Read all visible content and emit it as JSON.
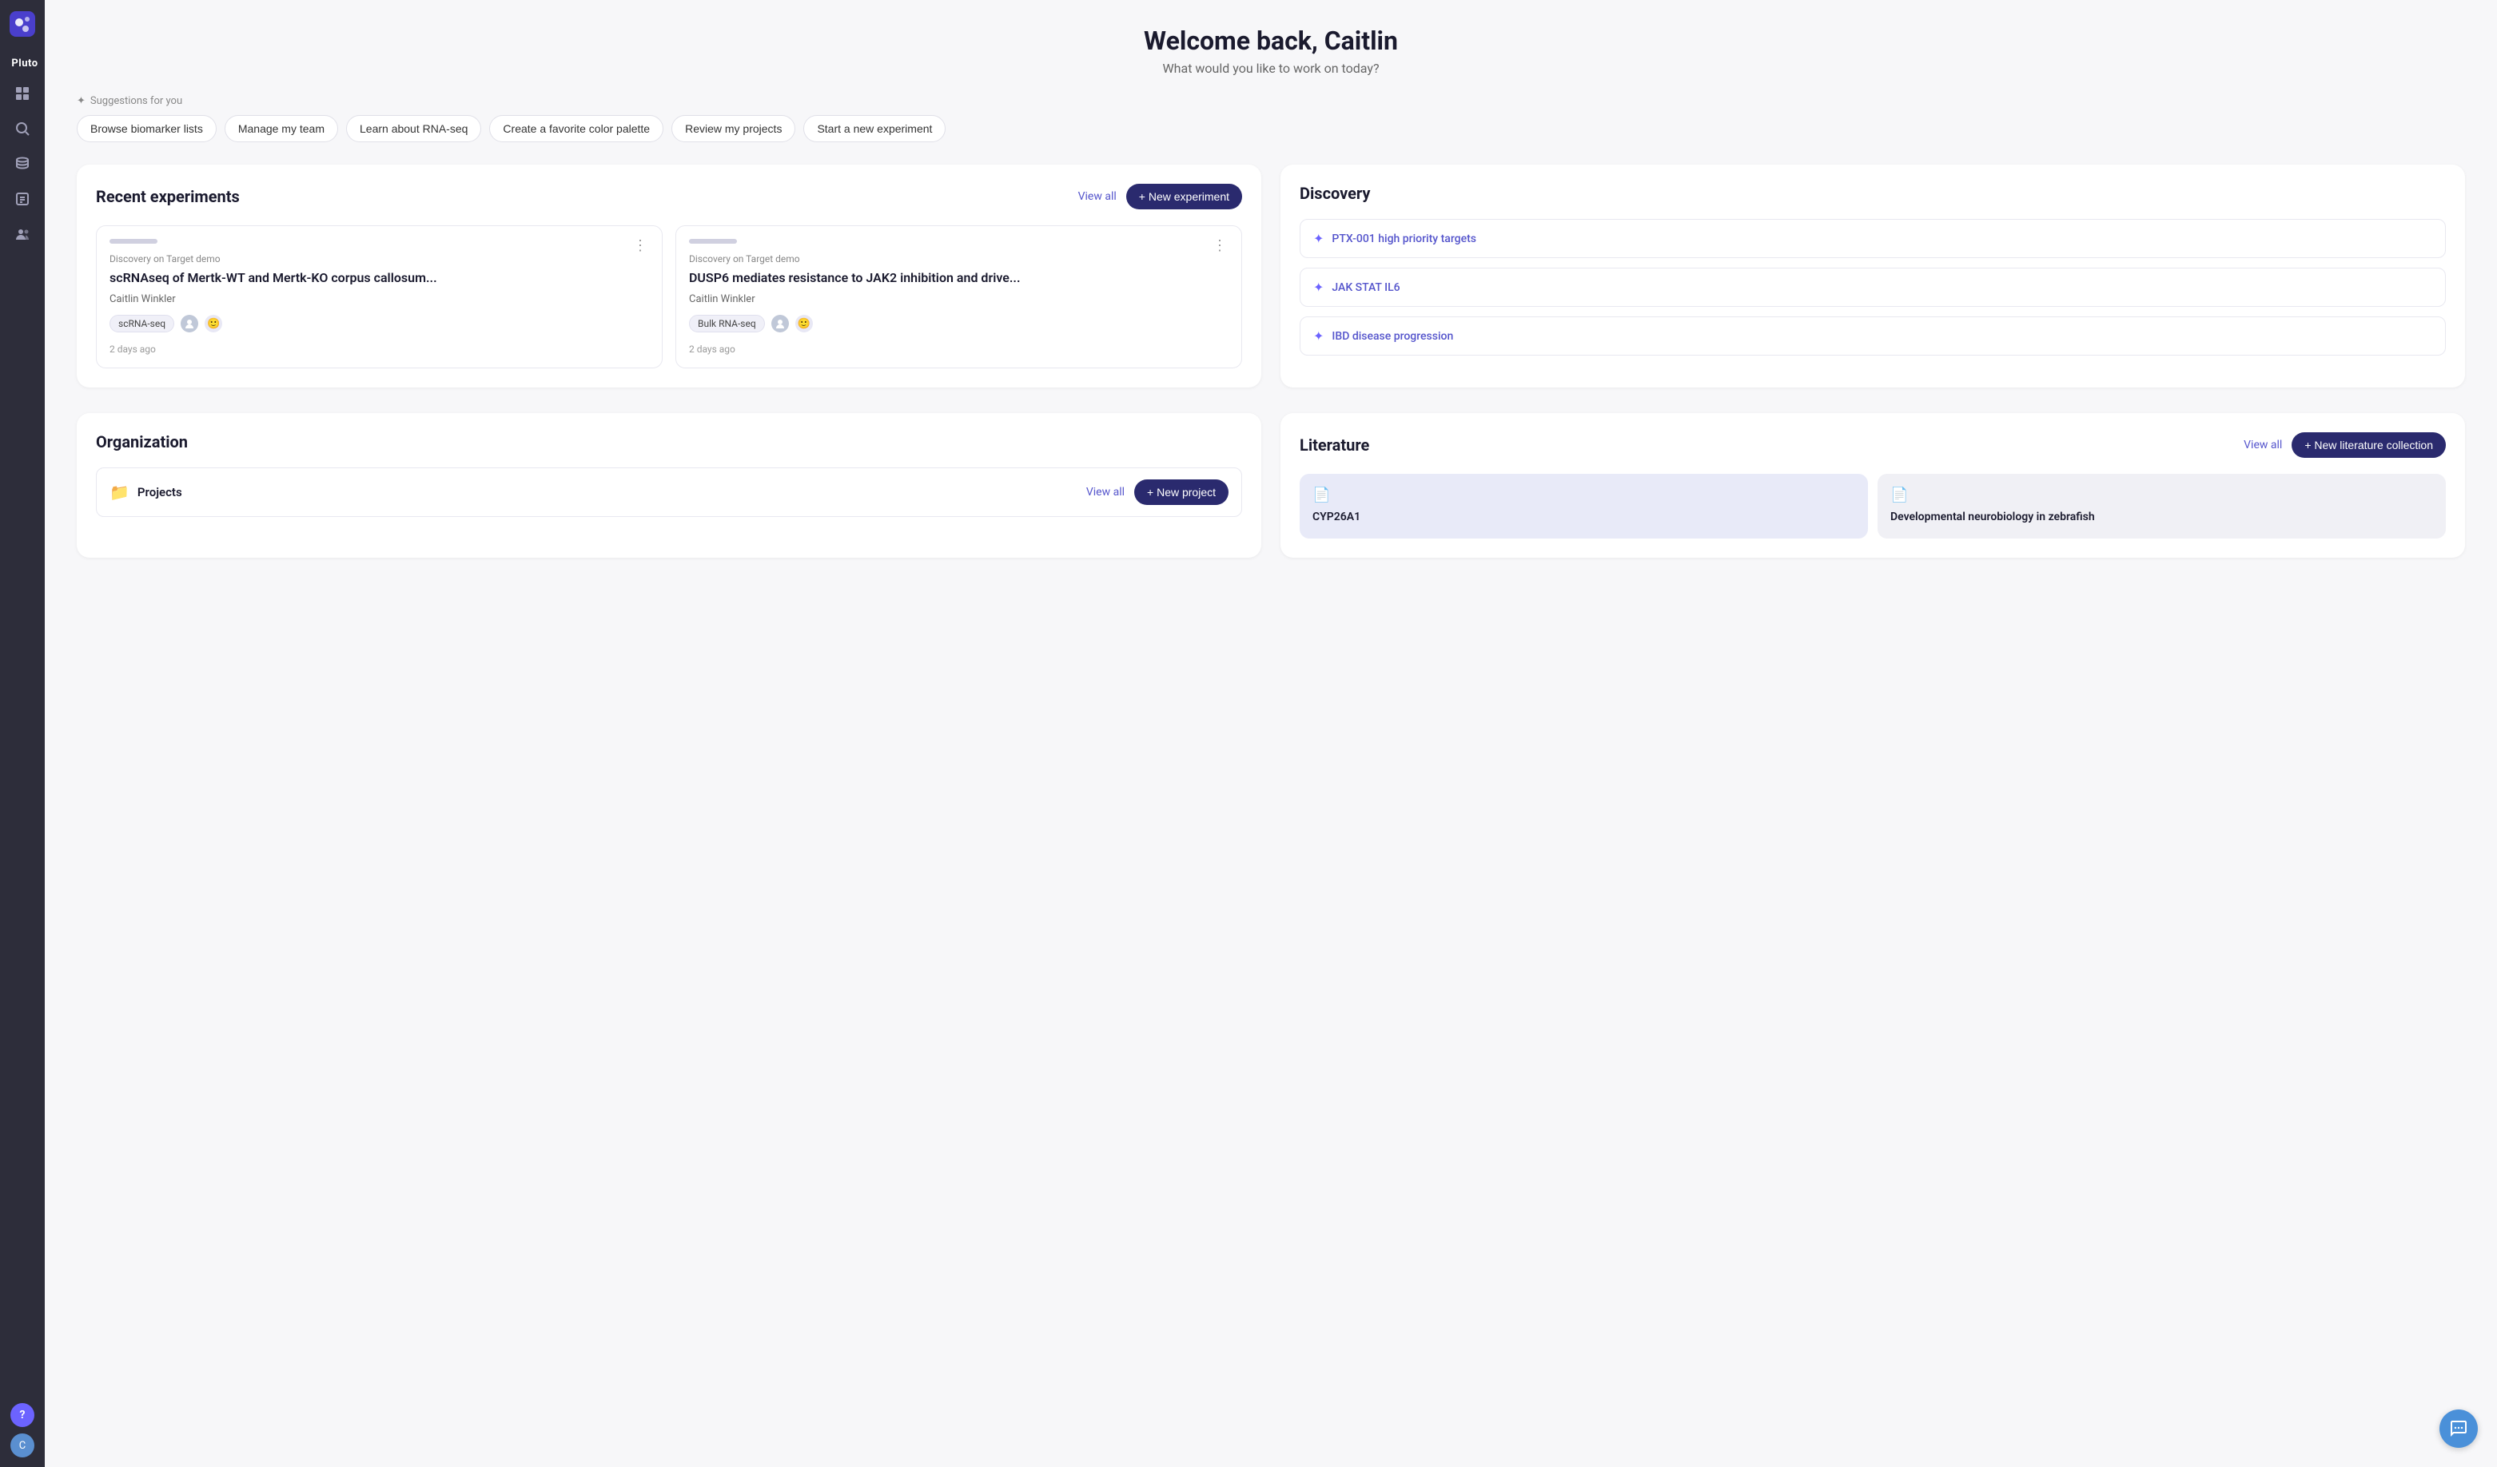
{
  "app": {
    "name": "Pluto"
  },
  "welcome": {
    "title": "Welcome back, Caitlin",
    "subtitle": "What would you like to work on today?"
  },
  "suggestions": {
    "label": "Suggestions for you",
    "chips": [
      "Browse biomarker lists",
      "Manage my team",
      "Learn about RNA-seq",
      "Create a favorite color palette",
      "Review my projects",
      "Start a new experiment"
    ]
  },
  "recent_experiments": {
    "title": "Recent experiments",
    "view_all": "View all",
    "new_btn": "+ New experiment",
    "cards": [
      {
        "demo_label": "Discovery on Target demo",
        "title": "scRNAseq of Mertk-WT and Mertk-KO corpus callosum...",
        "author": "Caitlin Winkler",
        "tag": "scRNA-seq",
        "time": "2 days ago"
      },
      {
        "demo_label": "Discovery on Target demo",
        "title": "DUSP6 mediates resistance to JAK2 inhibition and drive...",
        "author": "Caitlin Winkler",
        "tag": "Bulk RNA-seq",
        "time": "2 days ago"
      }
    ]
  },
  "discovery": {
    "title": "Discovery",
    "items": [
      {
        "label": "PTX-001 high priority targets"
      },
      {
        "label": "JAK STAT IL6"
      },
      {
        "label": "IBD disease progression"
      }
    ]
  },
  "organization": {
    "title": "Organization",
    "projects_label": "Projects",
    "view_all": "View all",
    "new_btn": "+ New project"
  },
  "literature": {
    "title": "Literature",
    "view_all": "View all",
    "new_btn": "+ New literature collection",
    "cards": [
      {
        "title": "CYP26A1",
        "style": "blue"
      },
      {
        "title": "Developmental neurobiology in zebrafish",
        "style": "gray"
      }
    ]
  },
  "sidebar": {
    "nav_items": [
      {
        "name": "dashboard",
        "icon": "▦"
      },
      {
        "name": "search",
        "icon": "🔍"
      },
      {
        "name": "database",
        "icon": "🗄"
      },
      {
        "name": "reports",
        "icon": "📊"
      },
      {
        "name": "team",
        "icon": "👥"
      }
    ],
    "help_label": "?",
    "avatar_label": "C"
  }
}
